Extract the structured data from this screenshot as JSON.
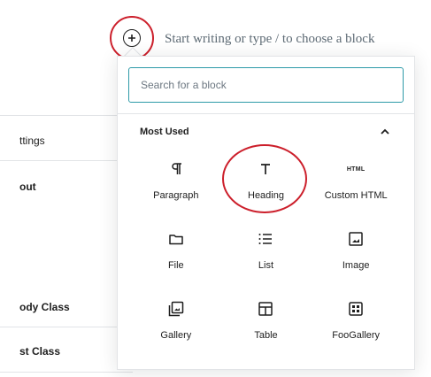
{
  "sidebar": {
    "items": [
      {
        "label": "ttings",
        "strong": false
      },
      {
        "label": "out",
        "strong": true
      },
      {
        "label": "ody Class",
        "strong": true
      },
      {
        "label": "st Class",
        "strong": true
      }
    ]
  },
  "editor": {
    "add_block_icon": "plus-circle-icon",
    "placeholder": "Start writing or type / to choose a block"
  },
  "inserter": {
    "search_placeholder": "Search for a block",
    "search_value": "",
    "section_title": "Most Used",
    "section_toggle_icon": "chevron-up-icon",
    "blocks": [
      {
        "label": "Paragraph",
        "icon": "paragraph-icon"
      },
      {
        "label": "Heading",
        "icon": "heading-icon"
      },
      {
        "label": "Custom HTML",
        "icon": "html-icon"
      },
      {
        "label": "File",
        "icon": "folder-icon"
      },
      {
        "label": "List",
        "icon": "list-icon"
      },
      {
        "label": "Image",
        "icon": "image-icon"
      },
      {
        "label": "Gallery",
        "icon": "gallery-icon"
      },
      {
        "label": "Table",
        "icon": "table-icon"
      },
      {
        "label": "FooGallery",
        "icon": "foogallery-icon"
      }
    ],
    "html_icon_text": "HTML"
  },
  "colors": {
    "highlight": "#cc1f2b",
    "search_focus": "#2e9aa8",
    "placeholder_text": "#5d6a74"
  }
}
